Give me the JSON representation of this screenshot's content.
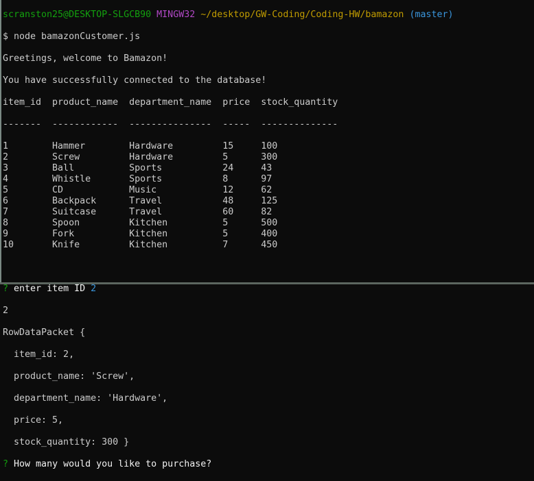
{
  "prompt": {
    "user_host": "scranston25@DESKTOP-SLGCB90",
    "system": "MINGW32",
    "path": "~/desktop/GW-Coding/Coding-HW/bamazon",
    "branch": "(master)"
  },
  "command": "$ node bamazonCustomer.js",
  "messages": [
    "Greetings, welcome to Bamazon!",
    "You have successfully connected to the database!"
  ],
  "table": {
    "headers": [
      "item_id",
      "product_name",
      "department_name",
      "price",
      "stock_quantity"
    ],
    "separators": [
      "-------",
      "------------",
      "---------------",
      "-----",
      "--------------"
    ],
    "rows": [
      [
        "1",
        "Hammer",
        "Hardware",
        "15",
        "100"
      ],
      [
        "2",
        "Screw",
        "Hardware",
        "5",
        "300"
      ],
      [
        "3",
        "Ball",
        "Sports",
        "24",
        "43"
      ],
      [
        "4",
        "Whistle",
        "Sports",
        "8",
        "97"
      ],
      [
        "5",
        "CD",
        "Music",
        "12",
        "62"
      ],
      [
        "6",
        "Backpack",
        "Travel",
        "48",
        "125"
      ],
      [
        "7",
        "Suitcase",
        "Travel",
        "60",
        "82"
      ],
      [
        "8",
        "Spoon",
        "Kitchen",
        "5",
        "500"
      ],
      [
        "9",
        "Fork",
        "Kitchen",
        "5",
        "400"
      ],
      [
        "10",
        "Knife",
        "Kitchen",
        "7",
        "450"
      ]
    ]
  },
  "question1": {
    "mark": "?",
    "text": "enter item ID",
    "answer": "2"
  },
  "echo": "2",
  "packet": [
    "RowDataPacket {",
    "  item_id: 2,",
    "  product_name: 'Screw',",
    "  department_name: 'Hardware',",
    "  price: 5,",
    "  stock_quantity: 300 }"
  ],
  "question2": {
    "mark": "?",
    "text": "How many would you like to purchase?"
  }
}
